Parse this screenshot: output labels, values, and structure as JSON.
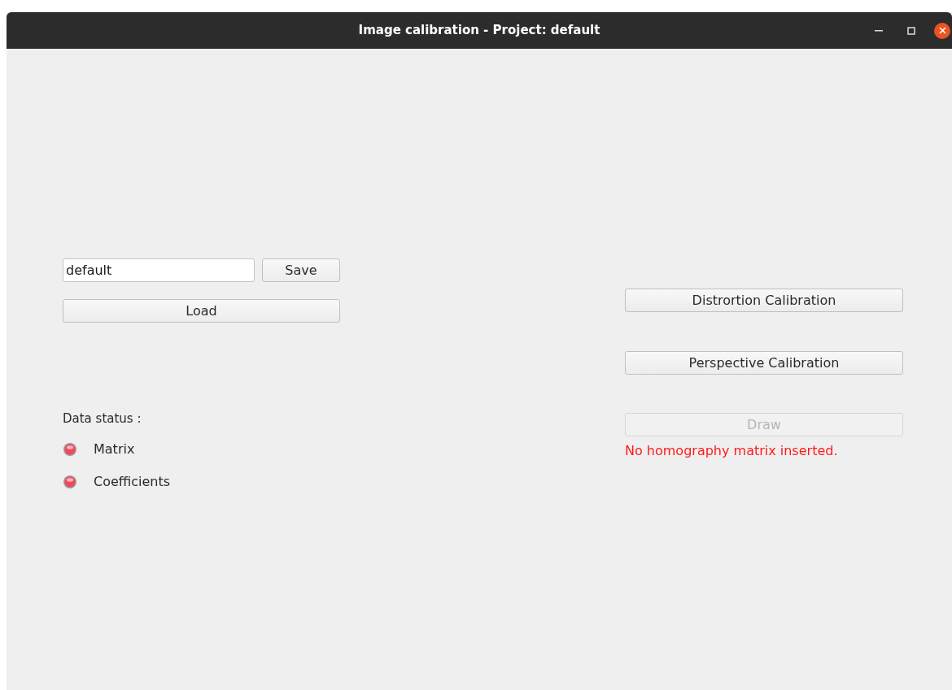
{
  "window": {
    "title": "Image calibration - Project: default"
  },
  "project": {
    "name_field": {
      "value": "default"
    },
    "save_button": {
      "label": "Save",
      "disabled": false
    },
    "load_button": {
      "label": "Load",
      "disabled": false
    }
  },
  "data_status": {
    "label": "Data status :",
    "items": [
      {
        "label": "Matrix",
        "loaded": false
      },
      {
        "label": "Coefficients",
        "loaded": false
      }
    ]
  },
  "actions": [
    {
      "label": "Distrortion Calibration",
      "disabled": false
    },
    {
      "label": "Perspective Calibration",
      "disabled": false
    },
    {
      "label": "Draw",
      "disabled": true
    }
  ],
  "error_message": "No homography matrix inserted."
}
